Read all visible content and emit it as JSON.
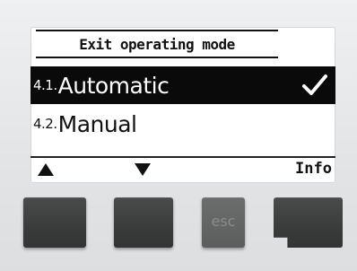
{
  "header": {
    "title": "Exit operating mode"
  },
  "menu": {
    "items": [
      {
        "number": "4.1.",
        "label": "Automatic",
        "selected": true
      },
      {
        "number": "4.2.",
        "label": "Manual",
        "selected": false
      }
    ]
  },
  "softkeys": {
    "left_icon": "up-triangle-icon",
    "middle_icon": "down-triangle-icon",
    "right_label": "Info"
  },
  "buttons": {
    "esc_label": "esc"
  },
  "colors": {
    "selection_bg": "#0a0a0a",
    "bezel": "#e4e6e7",
    "button": "#3a3b3b"
  }
}
